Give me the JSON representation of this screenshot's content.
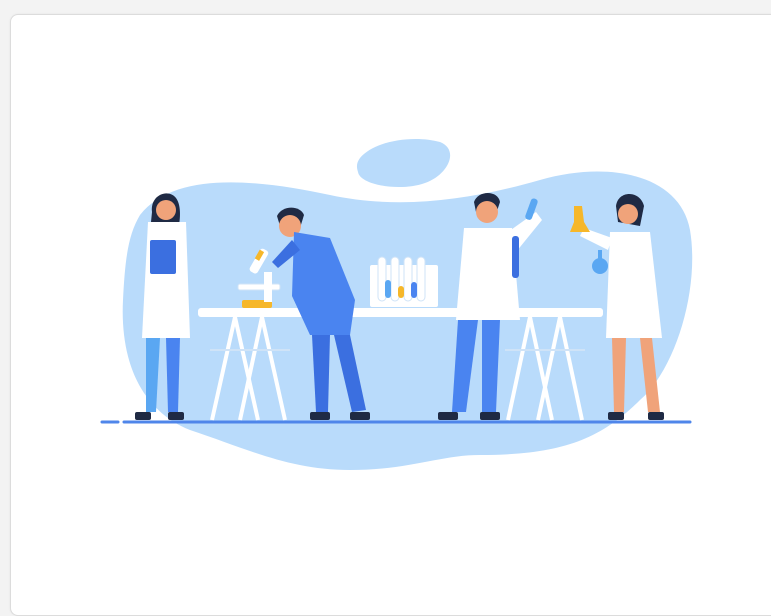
{
  "card": {
    "illustration": {
      "subject": "lab-scientists-illustration",
      "colors": {
        "blob": "#b9dbfb",
        "blob_small": "#b9dbfb",
        "coat": "#ffffff",
        "coat_shadow": "#dbe8f6",
        "blue_dark": "#3b6fe0",
        "blue_mid": "#4a84f0",
        "blue_light": "#5aa7f2",
        "hair": "#1f2a44",
        "skin": "#f0a37a",
        "floor": "#4f86ea",
        "yellow": "#f6b72a"
      }
    }
  }
}
